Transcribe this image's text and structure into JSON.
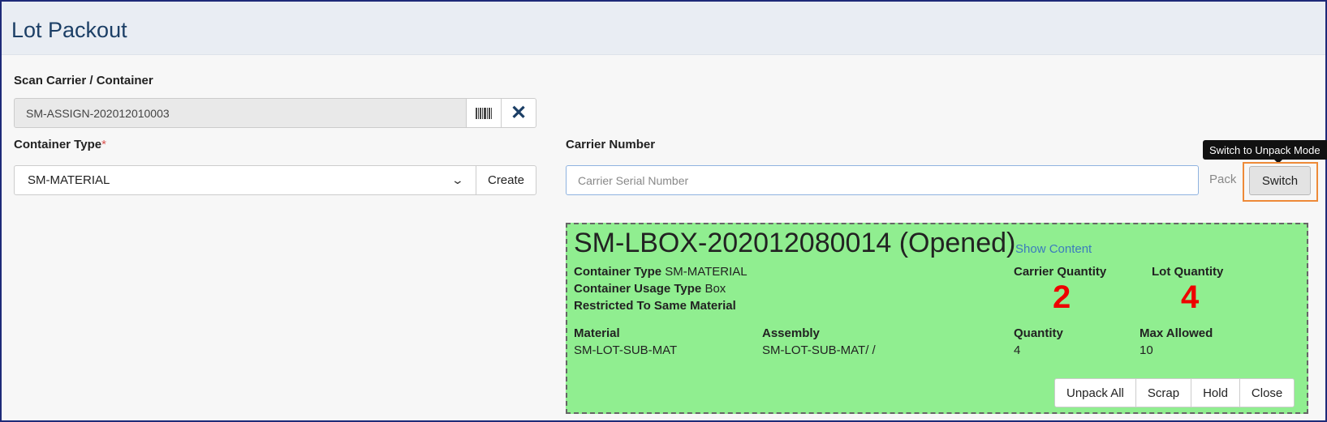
{
  "header": {
    "title": "Lot Packout"
  },
  "scan": {
    "label": "Scan Carrier / Container",
    "value": "SM-ASSIGN-202012010003",
    "barcode_icon": "barcode-icon",
    "clear_icon": "close-icon"
  },
  "container_type": {
    "label": "Container Type",
    "required_mark": "*",
    "selected": "SM-MATERIAL",
    "create_label": "Create"
  },
  "carrier": {
    "label": "Carrier Number",
    "placeholder": "Carrier Serial Number",
    "pack_label": "Pack",
    "switch_label": "Switch",
    "tooltip": "Switch to Unpack Mode"
  },
  "container_card": {
    "title": "SM-LBOX-202012080014 (Opened)",
    "show_content": "Show Content",
    "container_type_label": "Container Type",
    "container_type_value": "SM-MATERIAL",
    "usage_type_label": "Container Usage Type",
    "usage_type_value": "Box",
    "restricted_label": "Restricted To Same Material",
    "carrier_qty_label": "Carrier Quantity",
    "carrier_qty_value": "2",
    "lot_qty_label": "Lot Quantity",
    "lot_qty_value": "4",
    "columns": {
      "material": "Material",
      "assembly": "Assembly",
      "quantity": "Quantity",
      "max_allowed": "Max Allowed"
    },
    "row": {
      "material": "SM-LOT-SUB-MAT",
      "assembly": "SM-LOT-SUB-MAT/ /",
      "quantity": "4",
      "max_allowed": "10"
    },
    "actions": [
      "Unpack All",
      "Scrap",
      "Hold",
      "Close"
    ],
    "background_color": "#90ee90"
  },
  "colors": {
    "header_bg": "#e9edf3",
    "title": "#1c3f66",
    "highlight_orange": "#ee8a38",
    "big_number_red": "#ee0000"
  }
}
